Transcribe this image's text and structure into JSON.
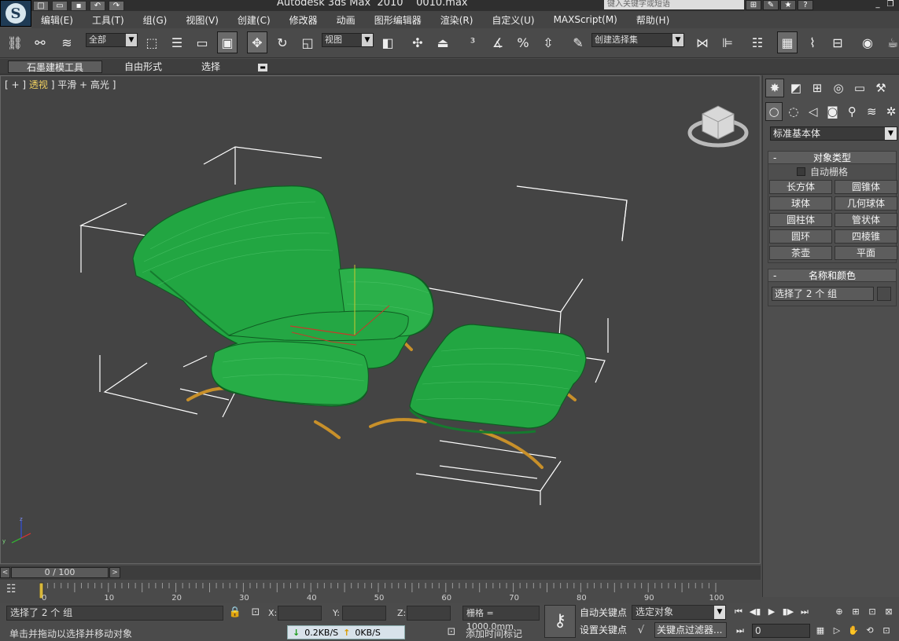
{
  "title_bar": {
    "app_title": "Autodesk 3ds Max  2010",
    "file_name": "0010.max",
    "search_placeholder": "键入关键字或短语"
  },
  "menu": {
    "items": [
      "编辑(E)",
      "工具(T)",
      "组(G)",
      "视图(V)",
      "创建(C)",
      "修改器",
      "动画",
      "图形编辑器",
      "渲染(R)",
      "自定义(U)",
      "MAXScript(M)",
      "帮助(H)"
    ]
  },
  "toolbar": {
    "selection_filter": "全部",
    "reference_coord": "视图",
    "named_selection_placeholder": "创建选择集"
  },
  "ribbon": {
    "tabs": [
      "石墨建模工具",
      "自由形式",
      "选择"
    ]
  },
  "viewport": {
    "label_prefix": "[ + ] ",
    "label_view": "透视",
    "label_rest": " ] 平滑 + 高光 ]"
  },
  "command_panel": {
    "category_dropdown": "标准基本体",
    "object_type": {
      "header": "对象类型",
      "autogrid_label": "自动栅格",
      "buttons": [
        "长方体",
        "圆锥体",
        "球体",
        "几何球体",
        "圆柱体",
        "管状体",
        "圆环",
        "四棱锥",
        "茶壶",
        "平面"
      ]
    },
    "name_color": {
      "header": "名称和颜色",
      "name_value": "选择了 2 个 组"
    }
  },
  "time_slider": {
    "position": "0 / 100",
    "ticks": [
      "0",
      "10",
      "20",
      "30",
      "40",
      "50",
      "60",
      "70",
      "80",
      "90",
      "100"
    ]
  },
  "status": {
    "selection_text": "选择了 2 个 组",
    "prompt_text": "单击并拖动以选择并移动对象",
    "x_label": "X:",
    "y_label": "Y:",
    "z_label": "Z:",
    "grid_text": "栅格 = 1000.0mm",
    "add_time_tag": "添加时间标记",
    "auto_key": "自动关键点",
    "set_key": "设置关键点",
    "selected_object": "选定对象",
    "key_filters": "关键点过滤器...",
    "frame_value": "0",
    "download_speed": "0.2KB/S",
    "upload_speed": "0KB/S"
  },
  "colors": {
    "viewport_bg": "#444444",
    "object_green": "#20a840",
    "selection_bracket": "#ffffff",
    "label_highlight": "#f0d060"
  }
}
